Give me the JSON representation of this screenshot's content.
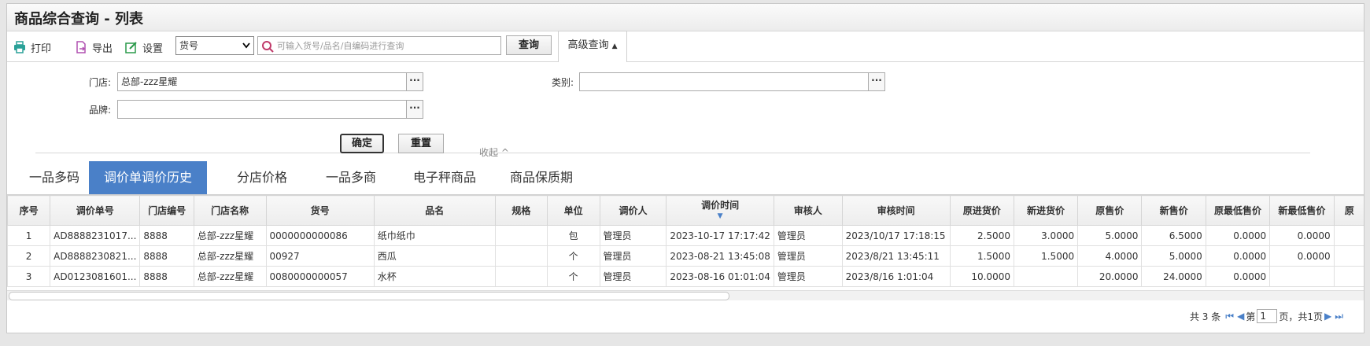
{
  "window": {
    "title": "商品综合查询 - 列表"
  },
  "toolbar": {
    "print_label": "打印",
    "export_label": "导出",
    "settings_label": "设置",
    "field_select_value": "货号",
    "search_placeholder": "可输入货号/品名/自编码进行查询",
    "query_label": "查询",
    "advanced_label": "高级查询"
  },
  "advanced": {
    "store_label": "门店:",
    "store_value": "总部-zzz星耀",
    "category_label": "类别:",
    "category_value": "",
    "brand_label": "品牌:",
    "brand_value": "",
    "confirm_label": "确定",
    "reset_label": "重置",
    "collapse_label": "收起"
  },
  "tabs": [
    "一品多码",
    "调价单调价历史",
    "分店价格",
    "一品多商",
    "电子秤商品",
    "商品保质期"
  ],
  "active_tab": 1,
  "table": {
    "columns": [
      "序号",
      "调价单号",
      "门店编号",
      "门店名称",
      "货号",
      "品名",
      "规格",
      "单位",
      "调价人",
      "调价时间",
      "审核人",
      "审核时间",
      "原进货价",
      "新进货价",
      "原售价",
      "新售价",
      "原最低售价",
      "新最低售价",
      "原"
    ],
    "rows": [
      [
        "1",
        "AD8888231017...",
        "8888",
        "总部-zzz星耀",
        "0000000000086",
        "纸巾纸巾",
        "",
        "包",
        "管理员",
        "2023-10-17 17:17:42",
        "管理员",
        "2023/10/17 17:18:15",
        "2.5000",
        "3.0000",
        "5.0000",
        "6.5000",
        "0.0000",
        "0.0000",
        ""
      ],
      [
        "2",
        "AD8888230821...",
        "8888",
        "总部-zzz星耀",
        "00927",
        "西瓜",
        "",
        "个",
        "管理员",
        "2023-08-21 13:45:08",
        "管理员",
        "2023/8/21 13:45:11",
        "1.5000",
        "1.5000",
        "4.0000",
        "5.0000",
        "0.0000",
        "0.0000",
        ""
      ],
      [
        "3",
        "AD0123081601...",
        "8888",
        "总部-zzz星耀",
        "0080000000057",
        "水杯",
        "",
        "个",
        "管理员",
        "2023-08-16 01:01:04",
        "管理员",
        "2023/8/16 1:01:04",
        "10.0000",
        "",
        "20.0000",
        "24.0000",
        "0.0000",
        "",
        ""
      ]
    ]
  },
  "pager": {
    "total_text": "共 3 条",
    "page_prefix": "第",
    "page_value": "1",
    "page_suffix": "页，共1页"
  },
  "colors": {
    "accent": "#4a80c8",
    "print_icon": "#2aa198",
    "export_icon": "#b050b0",
    "settings_icon": "#2a9a4a",
    "search_icon": "#c03a6a"
  }
}
